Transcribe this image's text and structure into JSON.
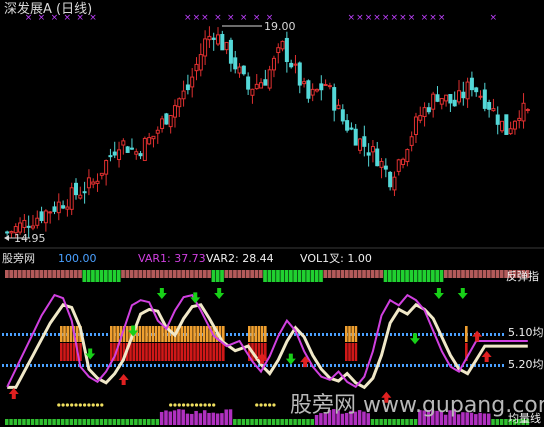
{
  "header": {
    "title": "深发展A (日线)"
  },
  "price_pane": {
    "high_label": "19.00",
    "low_label": "14.95"
  },
  "indicator_pane": {
    "name": "股旁网",
    "value_label": "100.00",
    "var1_label": "VAR1: 37.73",
    "var2_label": "VAR2: 28.44",
    "vol1_label": "VOL1叉: 1.00",
    "right_labels": [
      "反弹指",
      "5.10均",
      "5.20均",
      "均量线"
    ]
  },
  "watermark": "股旁网 www.gupang.com",
  "colors": {
    "background": "#000000",
    "up_candle": "#e03030",
    "down_candle": "#54d8d8",
    "signal_mark": "#c040ff",
    "green_band": "#20d030",
    "salmon_band": "#e07070",
    "orange_band": "#f0a030",
    "red_band": "#d01818",
    "blue_dots": "#4aa0ff",
    "arrow_up": "#e02020",
    "arrow_down": "#18d018",
    "curve_magenta": "#d040e0",
    "curve_cream": "#f0e8c8",
    "var1_color": "#d040e0",
    "var2_color": "#f0f0f0",
    "name_color": "#e0e0e0",
    "value_color": "#4aa0ff"
  },
  "chart_data": [
    {
      "type": "candlestick",
      "title": "深发展A (日线)",
      "x_count": 110,
      "price_range": [
        14.95,
        19.0
      ],
      "high_point": {
        "index": 48,
        "value": 19.0
      },
      "low_point": {
        "index": 0,
        "value": 14.95
      },
      "close_keypoints": [
        [
          0,
          15.05
        ],
        [
          8,
          15.4
        ],
        [
          14,
          15.7
        ],
        [
          20,
          16.0
        ],
        [
          26,
          16.8
        ],
        [
          30,
          16.6
        ],
        [
          34,
          16.9
        ],
        [
          38,
          17.4
        ],
        [
          42,
          17.8
        ],
        [
          46,
          18.7
        ],
        [
          48,
          18.9
        ],
        [
          52,
          18.4
        ],
        [
          56,
          17.8
        ],
        [
          60,
          18.0
        ],
        [
          64,
          18.6
        ],
        [
          66,
          18.3
        ],
        [
          70,
          17.6
        ],
        [
          74,
          17.9
        ],
        [
          78,
          17.2
        ],
        [
          82,
          16.8
        ],
        [
          86,
          16.5
        ],
        [
          89,
          16.1
        ],
        [
          92,
          16.6
        ],
        [
          96,
          17.3
        ],
        [
          100,
          17.7
        ],
        [
          104,
          17.5
        ],
        [
          108,
          17.9
        ],
        [
          112,
          17.5
        ],
        [
          116,
          17.0
        ],
        [
          119,
          17.4
        ],
        [
          122,
          17.3
        ]
      ],
      "signal_mark_indices": [
        5,
        8,
        11,
        14,
        17,
        20,
        42,
        44,
        46,
        49,
        52,
        55,
        58,
        61,
        80,
        82,
        84,
        86,
        88,
        90,
        92,
        94,
        97,
        99,
        101,
        113
      ],
      "series": [
        {
          "name": "up",
          "color": "#e03030"
        },
        {
          "name": "down",
          "color": "#54d8d8"
        }
      ]
    },
    {
      "type": "line",
      "title": "股旁网",
      "series_values": {
        "VAR1": 37.73,
        "VAR2": 28.44,
        "VOL1叉": 1.0
      },
      "var1_keypoints": [
        [
          0,
          5
        ],
        [
          4,
          40
        ],
        [
          8,
          75
        ],
        [
          11,
          95
        ],
        [
          13,
          92
        ],
        [
          15,
          70
        ],
        [
          17,
          25
        ],
        [
          19,
          15
        ],
        [
          21,
          10
        ],
        [
          23,
          20
        ],
        [
          25,
          35
        ],
        [
          27,
          60
        ],
        [
          29,
          85
        ],
        [
          31,
          90
        ],
        [
          33,
          88
        ],
        [
          35,
          70
        ],
        [
          37,
          62
        ],
        [
          39,
          80
        ],
        [
          41,
          93
        ],
        [
          43,
          95
        ],
        [
          45,
          80
        ],
        [
          48,
          55
        ],
        [
          51,
          45
        ],
        [
          54,
          50
        ],
        [
          57,
          30
        ],
        [
          59,
          20
        ],
        [
          61,
          35
        ],
        [
          63,
          55
        ],
        [
          65,
          70
        ],
        [
          67,
          60
        ],
        [
          69,
          40
        ],
        [
          71,
          25
        ],
        [
          73,
          15
        ],
        [
          75,
          12
        ],
        [
          77,
          20
        ],
        [
          79,
          10
        ],
        [
          81,
          5
        ],
        [
          83,
          15
        ],
        [
          85,
          40
        ],
        [
          87,
          75
        ],
        [
          89,
          90
        ],
        [
          91,
          85
        ],
        [
          93,
          95
        ],
        [
          95,
          90
        ],
        [
          97,
          80
        ],
        [
          99,
          60
        ],
        [
          101,
          40
        ],
        [
          103,
          25
        ],
        [
          105,
          20
        ],
        [
          107,
          35
        ],
        [
          109,
          50
        ]
      ],
      "up_arrow_indices": [
        1,
        24,
        53,
        62,
        79,
        98,
        100
      ],
      "down_arrow_indices": [
        17,
        26,
        32,
        39,
        44,
        59,
        85,
        90,
        95
      ],
      "ylim": [
        0,
        100
      ]
    }
  ]
}
